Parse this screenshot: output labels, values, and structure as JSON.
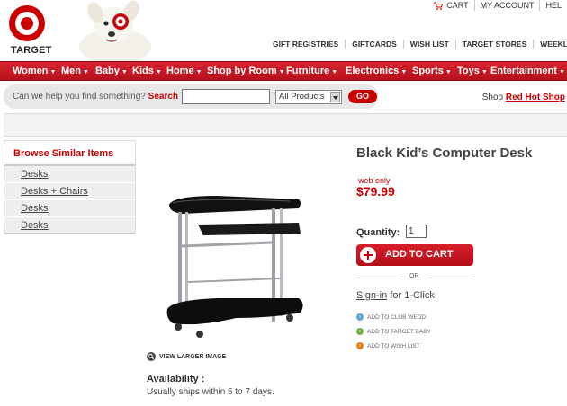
{
  "brand": {
    "logo_text": "TARGET",
    "accent_color": "#cc0000"
  },
  "utility_links": {
    "cart": "CART",
    "my_account": "MY ACCOUNT",
    "help": "HEL"
  },
  "top_nav": [
    "GIFT REGISTRIES",
    "GIFTCARDS",
    "WISH LIST",
    "TARGET STORES",
    "WEEKLY A"
  ],
  "categories": [
    "Women",
    "Men",
    "Baby",
    "Kids",
    "Home",
    "Shop by Room",
    "Furniture",
    "Electronics",
    "Sports",
    "Toys",
    "Entertainment"
  ],
  "search": {
    "prompt": "Can we help you find something?",
    "prompt_link": "Search",
    "input_value": "",
    "department": "All Products",
    "go_label": "GO"
  },
  "promo": {
    "prefix": "Shop",
    "link": "Red Hot Shop"
  },
  "sidebar": {
    "title": "Browse Similar Items",
    "items": [
      "Desks",
      "Desks + Chairs",
      "Desks",
      "Desks"
    ]
  },
  "product": {
    "title": "Black Kid’s Computer Desk",
    "web_only": "web only",
    "price": "$79.99",
    "quantity_label": "Quantity:",
    "quantity_value": "1",
    "add_to_cart": "ADD TO CART",
    "or": "OR",
    "signin_link": "Sign-in",
    "signin_suffix": "for 1-Click",
    "view_larger": "VIEW LARGER IMAGE",
    "availability_label": "Availability :",
    "availability_text": "Usually ships within 5 to 7 days."
  },
  "actions": [
    {
      "label": "ADD TO CLUB WEDD",
      "color": "#5aa9d6"
    },
    {
      "label": "ADD TO TARGET BABY",
      "color": "#6cb33f"
    },
    {
      "label": "ADD TO WISH LIST",
      "color": "#e8831b"
    }
  ]
}
